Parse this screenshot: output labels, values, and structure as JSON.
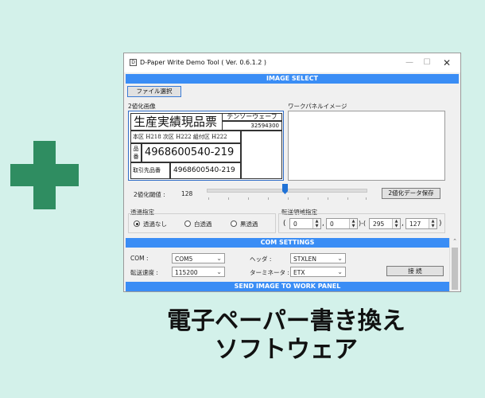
{
  "caption": {
    "line1": "電子ペーパー書き換え",
    "line2": "ソフトウェア"
  },
  "window": {
    "title": "D-Paper Write Demo Tool ( Ver. 0.6.1.2 )",
    "app_icon": "D",
    "buttons": {
      "minimize": "—",
      "maximize": "☐",
      "close": "✕"
    }
  },
  "image_select": {
    "header": "IMAGE SELECT",
    "file_button": "ファイル選択",
    "binary_image_label": "2値化画像",
    "work_panel_label": "ワークパネルイメージ",
    "threshold_label": "2値化閾値 :",
    "threshold_value": "128",
    "threshold_fraction": 0.5,
    "save_button": "2値化データ保存"
  },
  "preview_label": {
    "title": "生産実績現品票",
    "company": "デンソーウェーブ",
    "code": "32594300",
    "row2": "本区 H218 次区 H222 組付区 H222",
    "part_label": "品番",
    "part_number": "4968600540-219",
    "customer_label": "取引先品番",
    "customer_number": "4968600540-219"
  },
  "transparency": {
    "label": "透過指定",
    "options": [
      "透過なし",
      "白透過",
      "黒透過"
    ],
    "selected": 0
  },
  "transfer_area": {
    "label": "転送領域指定",
    "open_paren": "(",
    "x": "0",
    "y": "0",
    "w": "295",
    "h": "127",
    "comma": ",",
    "separator": ")-(",
    "close_paren": ")"
  },
  "com_settings": {
    "header": "COM SETTINGS",
    "com_label": "COM :",
    "com_value": "COM5",
    "header_label": "ヘッダ :",
    "header_value": "STXLEN",
    "speed_label": "転送速度 :",
    "speed_value": "115200",
    "terminator_label": "ターミネータ :",
    "terminator_value": "ETX",
    "connect_button": "接 続"
  },
  "send": {
    "header": "SEND IMAGE TO WORK PANEL"
  },
  "colors": {
    "accent": "#3a8df5",
    "plus": "#2f8d61",
    "background": "#d3f1ea"
  }
}
